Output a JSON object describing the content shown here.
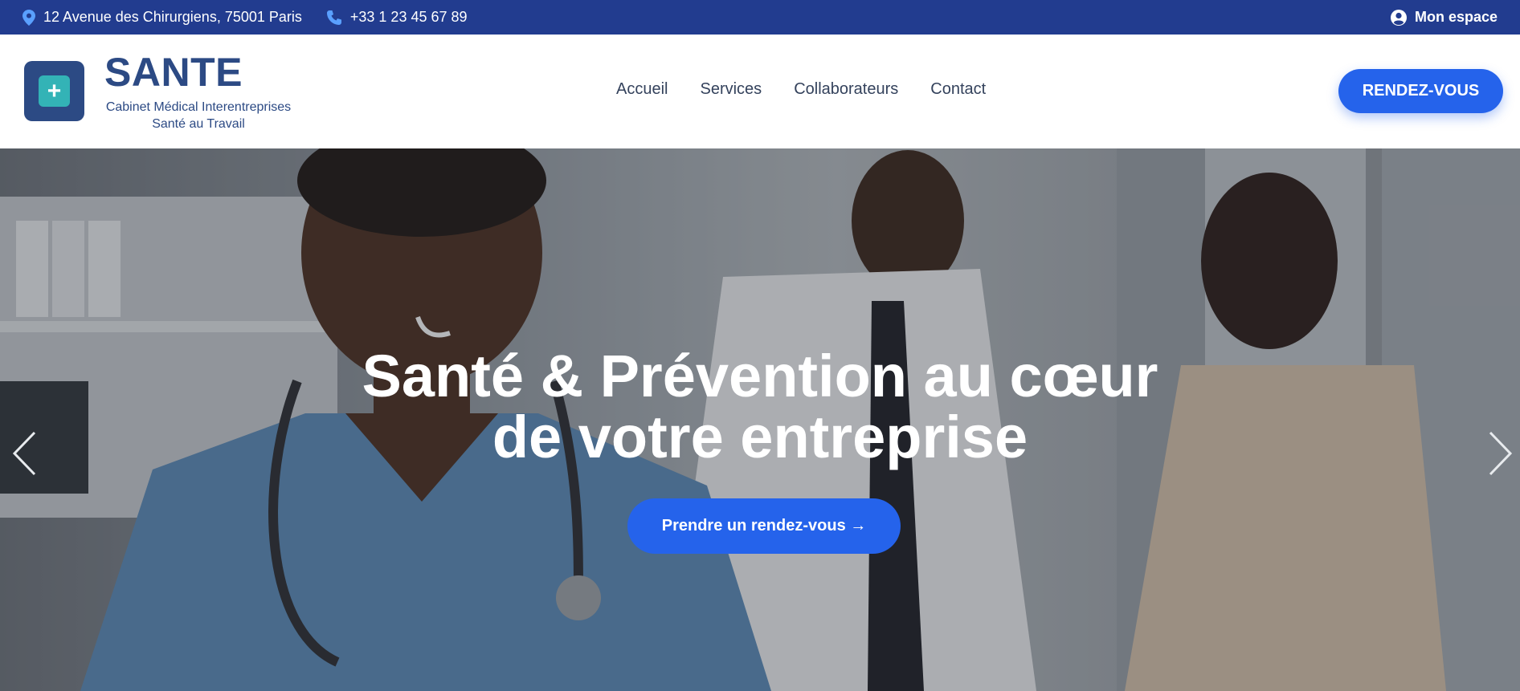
{
  "topbar": {
    "address": "12 Avenue des Chirurgiens, 75001 Paris",
    "phone": "+33 1 23 45 67 89",
    "account_label": "Mon espace"
  },
  "header": {
    "logo_symbol": "+",
    "brand_name": "SANTE",
    "tagline_line1": "Cabinet Médical Interentreprises",
    "tagline_line2": "Santé au Travail",
    "nav": {
      "home": "Accueil",
      "services": "Services",
      "team": "Collaborateurs",
      "contact": "Contact"
    },
    "cta_label": "RENDEZ-VOUS"
  },
  "hero": {
    "title_line1": "Santé & Prévention au cœur",
    "title_line2": "de votre entreprise",
    "button_label": "Prendre un rendez-vous →"
  },
  "colors": {
    "topbar_bg": "#223c8f",
    "brand": "#2c4a84",
    "logo_accent": "#33b3b6",
    "primary": "#2563eb",
    "nav_text": "#34425c"
  },
  "icons": {
    "address": "map-pin-icon",
    "phone": "phone-icon",
    "account": "user-circle-icon",
    "prev": "chevron-left-icon",
    "next": "chevron-right-icon"
  }
}
